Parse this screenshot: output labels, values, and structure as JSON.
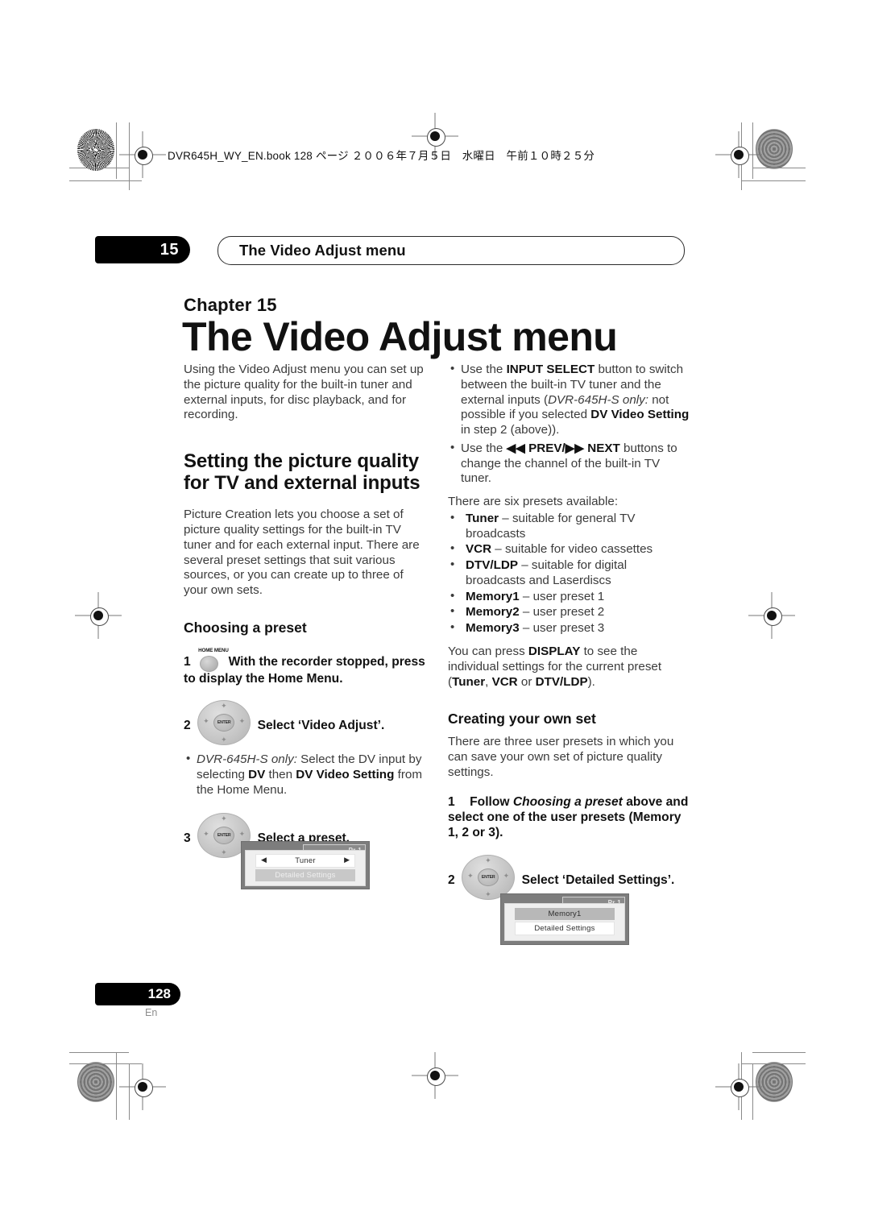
{
  "book_header": "DVR645H_WY_EN.book  128 ページ  ２００６年７月５日　水曜日　午前１０時２５分",
  "running_head": {
    "chapter_number": "15",
    "title": "The Video Adjust menu"
  },
  "chapter_opener": {
    "label": "Chapter 15",
    "title": "The Video Adjust menu"
  },
  "left_column": {
    "intro": "Using the Video Adjust menu you can set up the picture quality for the built-in tuner and external inputs, for disc playback, and for recording.",
    "section_heading": "Setting the picture quality for TV and external inputs",
    "section_intro": "Picture Creation lets you choose a set of picture quality settings for the built-in TV tuner and for each external input. There are several preset settings that suit various sources, or you can create up to three of your own sets.",
    "sub_heading": "Choosing a preset",
    "step1": {
      "num": "1",
      "icon_label": "HOME MENU",
      "text": "With the recorder stopped, press to display the Home Menu."
    },
    "step2": {
      "num": "2",
      "icon_label": "ENTER",
      "text": "Select ‘Video Adjust’.",
      "note_italic": "DVR-645H-S only:",
      "note_a": " Select the DV input by selecting ",
      "note_b1": "DV",
      "note_c": " then ",
      "note_b2": "DV Video Setting",
      "note_d": " from the Home Menu."
    },
    "step3": {
      "num": "3",
      "icon_label": "ENTER",
      "text": "Select a preset."
    },
    "osd": {
      "pr_label": "Pr 1",
      "row_selected": "Tuner",
      "row_dim": "Detailed Settings",
      "arrow_left": "◀",
      "arrow_right": "▶"
    }
  },
  "right_column": {
    "bullets_top": [
      {
        "a": "Use the ",
        "b1": "INPUT SELECT",
        "c": " button to switch between the built-in TV tuner and the external inputs (",
        "i": "DVR-645H-S only:",
        "d": " not possible if you selected ",
        "b2": "DV Video Setting",
        "e": " in step 2 (above))."
      },
      {
        "a": "Use the ",
        "b1": "◀◀ PREV/▶▶ NEXT",
        "c": " buttons to change the channel of the built-in TV tuner.",
        "i": "",
        "d": "",
        "b2": "",
        "e": ""
      }
    ],
    "presets_lead": "There are six presets available:",
    "presets": [
      {
        "name": "Tuner",
        "desc": " – suitable for general TV broadcasts"
      },
      {
        "name": "VCR",
        "desc": " – suitable for video cassettes"
      },
      {
        "name": "DTV/LDP",
        "desc": " – suitable for digital broadcasts and Laserdiscs"
      },
      {
        "name": "Memory1",
        "desc": " – user preset 1"
      },
      {
        "name": "Memory2",
        "desc": " – user preset 2"
      },
      {
        "name": "Memory3",
        "desc": " – user preset 3"
      }
    ],
    "display_note": {
      "a": "You can press ",
      "b1": "DISPLAY",
      "c": " to see the individual settings for the current preset (",
      "b2": "Tuner",
      "d": ", ",
      "b3": "VCR",
      "e": " or ",
      "b4": "DTV/LDP",
      "f": ")."
    },
    "sub_heading": "Creating your own set",
    "sub_intro": "There are three user presets in which you can save your own set of picture quality settings.",
    "step1": {
      "num": "1",
      "a": "Follow ",
      "i": "Choosing a preset",
      "b": " above and select one of the user presets (Memory 1, 2 or 3)."
    },
    "step2": {
      "num": "2",
      "icon_label": "ENTER",
      "text": "Select ‘Detailed Settings’."
    },
    "osd": {
      "pr_label": "Pr 1",
      "row_gray": "Memory1",
      "row_white": "Detailed Settings"
    }
  },
  "footer": {
    "page_number": "128",
    "language": "En"
  }
}
